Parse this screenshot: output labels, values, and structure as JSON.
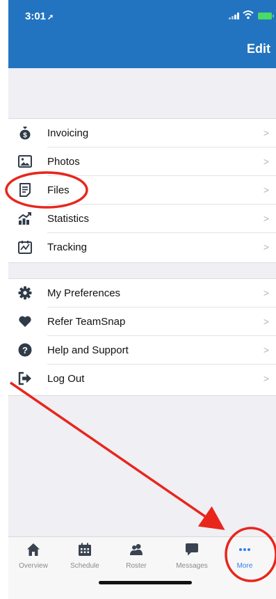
{
  "status_bar": {
    "time": "3:01"
  },
  "nav": {
    "edit_label": "Edit"
  },
  "menu_primary": [
    {
      "label": "Invoicing",
      "icon": "money-bag-icon"
    },
    {
      "label": "Photos",
      "icon": "photo-icon"
    },
    {
      "label": "Files",
      "icon": "file-icon"
    },
    {
      "label": "Statistics",
      "icon": "statistics-icon"
    },
    {
      "label": "Tracking",
      "icon": "tracking-icon"
    }
  ],
  "menu_secondary": [
    {
      "label": "My Preferences",
      "icon": "gear-icon"
    },
    {
      "label": "Refer TeamSnap",
      "icon": "heart-icon"
    },
    {
      "label": "Help and Support",
      "icon": "question-icon"
    },
    {
      "label": "Log Out",
      "icon": "logout-icon"
    }
  ],
  "tabs": [
    {
      "label": "Overview",
      "icon": "home-icon"
    },
    {
      "label": "Schedule",
      "icon": "calendar-icon"
    },
    {
      "label": "Roster",
      "icon": "people-icon"
    },
    {
      "label": "Messages",
      "icon": "chat-icon"
    },
    {
      "label": "More",
      "icon": "more-icon",
      "active": true
    }
  ],
  "colors": {
    "nav_blue": "#2374c0",
    "active_tab": "#2f80ed",
    "annotation_red": "#e8261c",
    "text_dark": "#2f3b48"
  }
}
